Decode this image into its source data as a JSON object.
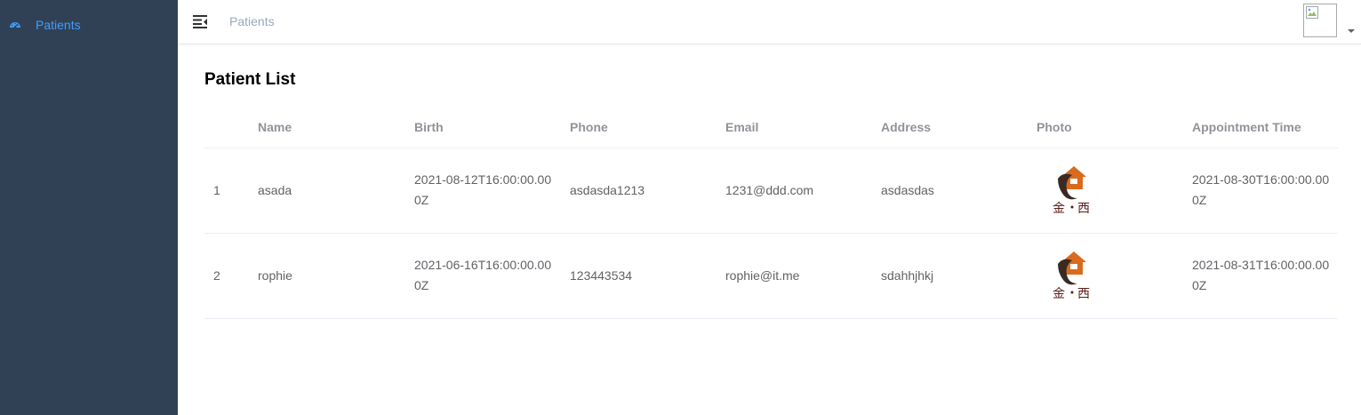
{
  "sidebar": {
    "items": [
      {
        "label": "Patients",
        "icon": "dashboard-icon",
        "active": true,
        "color": "#409eff"
      }
    ],
    "background": "#304156"
  },
  "navbar": {
    "breadcrumb": "Patients",
    "menu_icon": "hamburger-icon",
    "avatar_icon": "broken-image-icon",
    "dropdown_icon": "caret-down-icon"
  },
  "main": {
    "title": "Patient List",
    "table": {
      "columns": [
        "",
        "Name",
        "Birth",
        "Phone",
        "Email",
        "Address",
        "Photo",
        "Appointment Time"
      ],
      "rows": [
        {
          "index": "1",
          "name": "asada",
          "birth": "2021-08-12T16:00:00.000Z",
          "phone": "asdasda1213",
          "email": "1231@ddd.com",
          "address": "asdasdas",
          "photo_icon": "house-logo-icon",
          "appointment": "2021-08-30T16:00:00.000Z"
        },
        {
          "index": "2",
          "name": "rophie",
          "birth": "2021-06-16T16:00:00.000Z",
          "phone": "123443534",
          "email": "rophie@it.me",
          "address": "sdahhjhkj",
          "photo_icon": "house-logo-icon",
          "appointment": "2021-08-31T16:00:00.000Z"
        }
      ]
    }
  }
}
